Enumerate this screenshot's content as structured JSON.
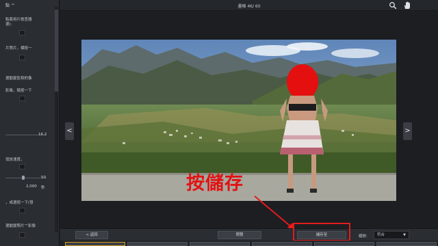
{
  "left_panel": {
    "title": "點 ™",
    "text_lines": [
      "",
      "",
      "點套用片檢查器",
      "選):",
      "",
      "片照片，標按一",
      "",
      "",
      "選動變區相的像",
      "影像，隨按一下",
      "",
      "",
      "",
      "",
      "",
      "",
      "增放速度，",
      "",
      "",
      "",
      "",
      "，或選按一下(發",
      "",
      "",
      "選動變照片™影像"
    ],
    "value_1": "16.2",
    "value_2": "50",
    "value_3": "2,000",
    "value_3_unit": "秒"
  },
  "top_bar": {
    "title": "畫格  46/ 60",
    "search_icon": "search-icon",
    "hand_icon": "hand-icon"
  },
  "nav": {
    "prev_label": "<",
    "next_label": ">"
  },
  "overlay": {
    "text": "按儲存"
  },
  "bottom_bar": {
    "back_label": "返回",
    "preview_label": "預覽",
    "save_label": "儲存至",
    "zoom_label": "縮放:",
    "zoom_value": "符合"
  },
  "colors": {
    "highlight": "#e41c1c",
    "overlay_text": "#e11414"
  }
}
